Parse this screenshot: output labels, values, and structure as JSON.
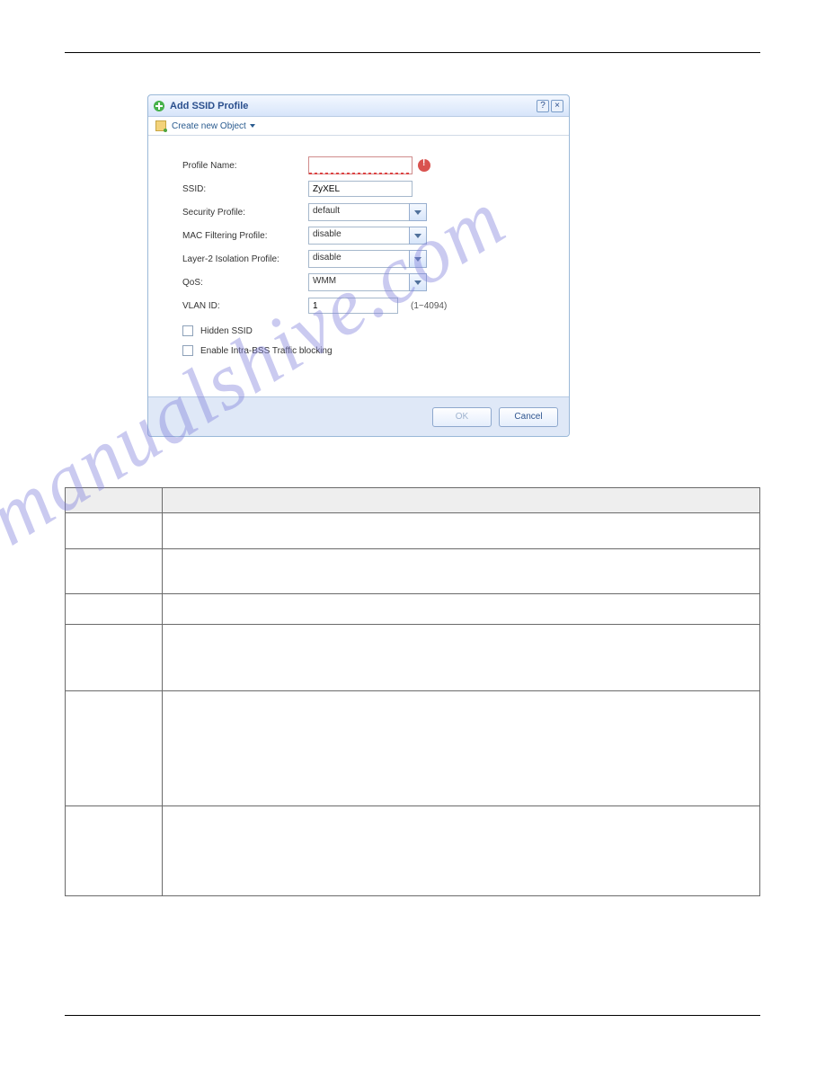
{
  "dialog": {
    "title": "Add SSID Profile",
    "createMenu": "Create new Object",
    "labels": {
      "profileName": "Profile Name:",
      "ssid": "SSID:",
      "securityProfile": "Security Profile:",
      "macFiltering": "MAC Filtering Profile:",
      "layer2Isolation": "Layer-2 Isolation Profile:",
      "qos": "QoS:",
      "vlanId": "VLAN ID:"
    },
    "values": {
      "profileName": "",
      "ssid": "ZyXEL",
      "securityProfile": "default",
      "macFiltering": "disable",
      "layer2Isolation": "disable",
      "qos": "WMM",
      "vlanId": "1",
      "vlanHint": "(1~4094)"
    },
    "checkboxes": {
      "hiddenSsid": "Hidden SSID",
      "intraBss": "Enable Intra-BSS Traffic blocking"
    },
    "buttons": {
      "ok": "OK",
      "cancel": "Cancel"
    }
  },
  "watermark": "manualshive.com"
}
